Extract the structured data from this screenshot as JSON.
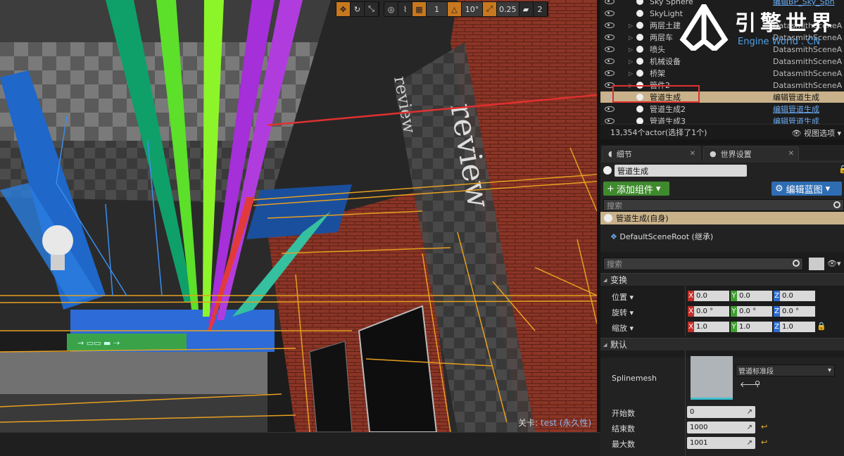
{
  "viewport": {
    "toolbar": {
      "grid_value": "1",
      "rotation_snap": "10°",
      "scale_snap": "0.25",
      "camera_speed": "2"
    },
    "scene_text_review": "review",
    "level_label": "关卡:",
    "level_name": "test (永久性)"
  },
  "logo": {
    "cn": "引擎世界",
    "en": "Engine World . CN"
  },
  "outliner": {
    "rows": [
      {
        "label": "Sky Sphere",
        "type": "编辑BP_Sky_Sph"
      },
      {
        "label": "SkyLight",
        "type": ""
      },
      {
        "label": "两层土建",
        "type": "DatasmithSceneA"
      },
      {
        "label": "两层车",
        "type": "DatasmithSceneA"
      },
      {
        "label": "喷头",
        "type": "DatasmithSceneA"
      },
      {
        "label": "机械设备",
        "type": "DatasmithSceneA"
      },
      {
        "label": "桥架",
        "type": "DatasmithSceneA"
      },
      {
        "label": "管件2",
        "type": "DatasmithSceneA"
      },
      {
        "label": "管道生成",
        "type": "编辑管道生成"
      },
      {
        "label": "管道生成2",
        "type": "编辑管道生成"
      },
      {
        "label": "管道生成3",
        "type": "编辑管道生成"
      }
    ],
    "status": "13,354个actor(选择了1个)",
    "view_options": "视图选项"
  },
  "details": {
    "tab_details": "细节",
    "tab_world": "世界设置",
    "actor_name": "管道生成",
    "add_component": "添加组件",
    "edit_blueprint": "编辑蓝图",
    "search_placeholder": "搜索",
    "self_component": "管道生成(自身)",
    "root_component": "DefaultSceneRoot (继承)",
    "search2_placeholder": "搜索",
    "transform_section": "变换",
    "location_label": "位置",
    "rotation_label": "旋转",
    "scale_label": "缩放",
    "location": {
      "x": "0.0",
      "y": "0.0",
      "z": "0.0"
    },
    "rotation": {
      "x": "0.0 °",
      "y": "0.0 °",
      "z": "0.0 °"
    },
    "scale": {
      "x": "1.0",
      "y": "1.0",
      "z": "1.0"
    },
    "default_section": "默认",
    "splinemesh_label": "Splinemesh",
    "splinemesh_asset": "管道标准段",
    "start_label": "开始数",
    "start_value": "0",
    "end_label": "结束数",
    "end_value": "1000",
    "max_label": "最大数",
    "max_value": "1001"
  },
  "axis_letters": {
    "x": "X",
    "y": "Y",
    "z": "Z"
  },
  "colors": {
    "accent_orange": "#c8781e",
    "selection_tan": "#c9b18a",
    "highlight_red": "#e03030",
    "link_blue": "#6aaaf0"
  }
}
